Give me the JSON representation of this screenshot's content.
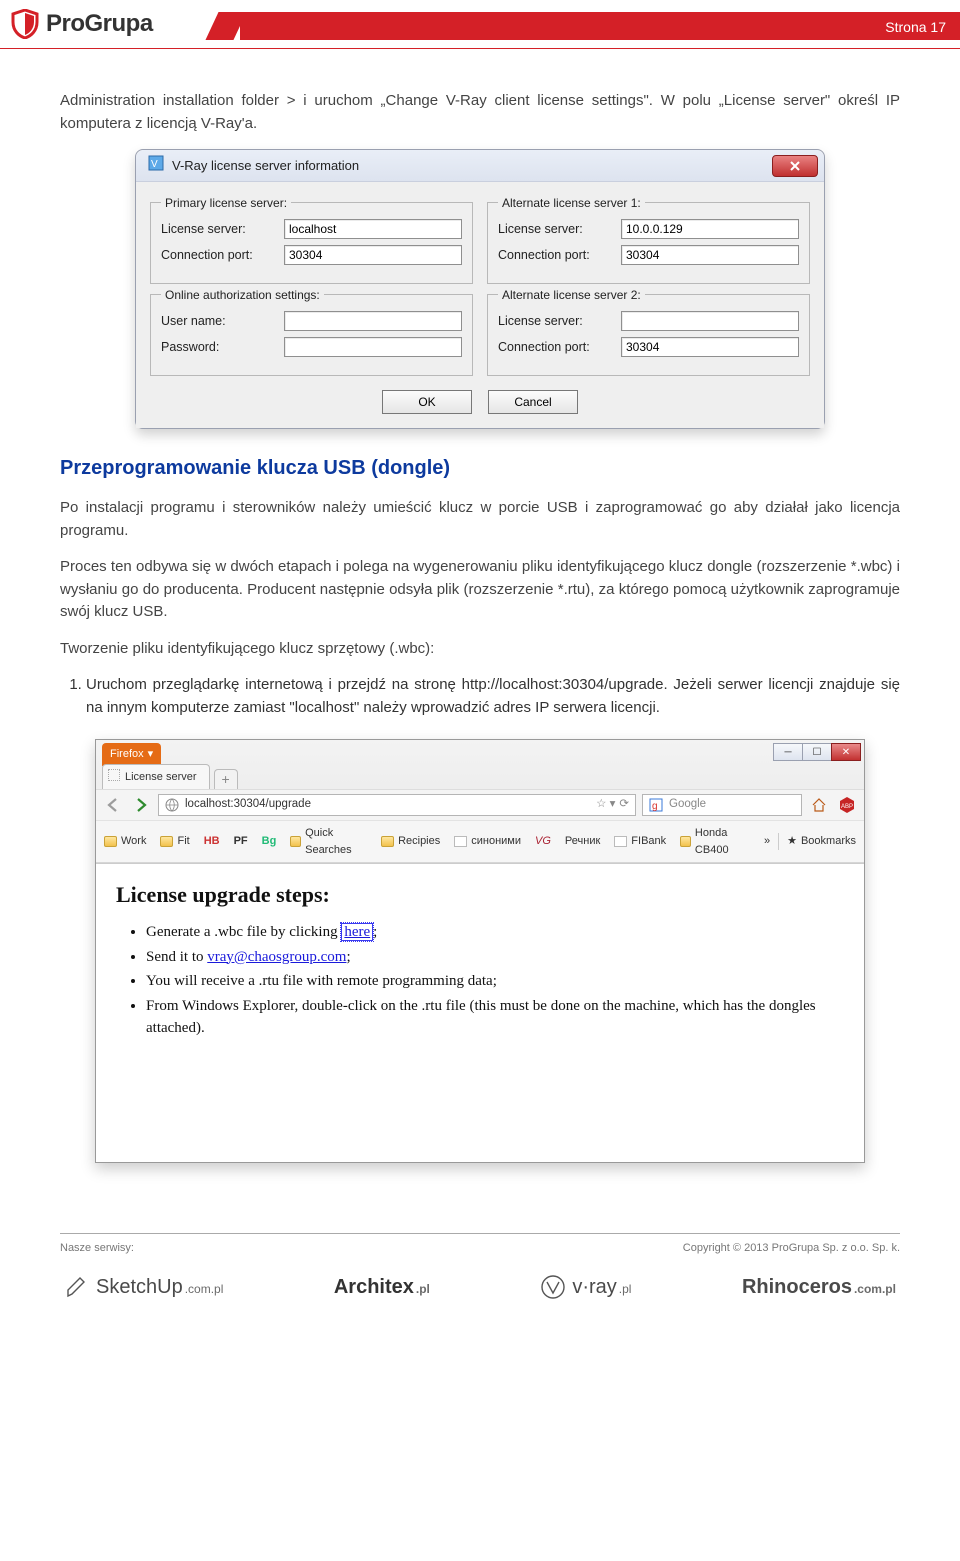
{
  "header": {
    "brand_first": "Pro",
    "brand_second": "Grupa",
    "page_label": "Strona 17"
  },
  "intro_paragraph": "Administration installation folder > i uruchom „Change V-Ray client license settings\". W polu „License server\" określ IP komputera z licencją V-Ray'a.",
  "vray_dialog": {
    "title": "V-Ray license server information",
    "groups": {
      "primary": {
        "legend": "Primary license server:",
        "server_label": "License server:",
        "server_value": "localhost",
        "port_label": "Connection port:",
        "port_value": "30304"
      },
      "alt1": {
        "legend": "Alternate license server 1:",
        "server_label": "License server:",
        "server_value": "10.0.0.129",
        "port_label": "Connection port:",
        "port_value": "30304"
      },
      "online": {
        "legend": "Online authorization settings:",
        "user_label": "User name:",
        "user_value": "",
        "pass_label": "Password:",
        "pass_value": ""
      },
      "alt2": {
        "legend": "Alternate license server 2:",
        "server_label": "License server:",
        "server_value": "",
        "port_label": "Connection port:",
        "port_value": "30304"
      }
    },
    "ok_label": "OK",
    "cancel_label": "Cancel"
  },
  "section_title": "Przeprogramowanie klucza USB (dongle)",
  "p1": "Po instalacji programu i sterowników należy umieścić klucz w porcie USB i zaprogramować go aby działał jako licencja programu.",
  "p2": "Proces ten odbywa się w dwóch etapach i polega na wygenerowaniu pliku identyfikującego klucz dongle (rozszerzenie *.wbc) i wysłaniu go do producenta. Producent następnie odsyła plik (rozszerzenie *.rtu), za którego pomocą użytkownik zaprogramuje swój klucz USB.",
  "subheading": "Tworzenie pliku identyfikującego klucz sprzętowy (.wbc):",
  "steps": [
    "Uruchom przeglądarkę internetową i przejdź na stronę http://localhost:30304/upgrade. Jeżeli serwer licencji znajduje się na innym komputerze zamiast \"localhost\" należy wprowadzić adres IP serwera licencji."
  ],
  "browser": {
    "firefox_label": "Firefox",
    "tab_title": "License server",
    "url": "localhost:30304/upgrade",
    "search_placeholder": "Google",
    "bookmarks": [
      "Work",
      "Fit",
      "HB",
      "PF",
      "Bg",
      "Quick Searches",
      "Recipies",
      "синоними",
      "VG",
      "Речник",
      "FIBank",
      "Honda CB400"
    ],
    "bookmarks_right": "»",
    "bookmarks_btn": "Bookmarks",
    "page_heading": "License upgrade steps:",
    "bullets": [
      {
        "pre": "Generate a .wbc file by clicking ",
        "link": "here",
        "post": ";"
      },
      {
        "pre": "Send it to ",
        "link": "vray@chaosgroup.com",
        "post": ";"
      },
      {
        "plain": "You will receive a .rtu file with remote programming data;"
      },
      {
        "plain": "From Windows Explorer, double-click on the .rtu file (this must be done on the machine, which has the dongles attached)."
      }
    ]
  },
  "footer": {
    "left": "Nasze serwisy:",
    "right": "Copyright © 2013 ProGrupa Sp. z o.o. Sp. k.",
    "logos": {
      "sketchup": "SketchUp",
      "architex": "Architex",
      "vray": "v·ray",
      "rhino": "Rhinoceros",
      "tld": ".com.pl",
      "pl": ".pl"
    }
  }
}
